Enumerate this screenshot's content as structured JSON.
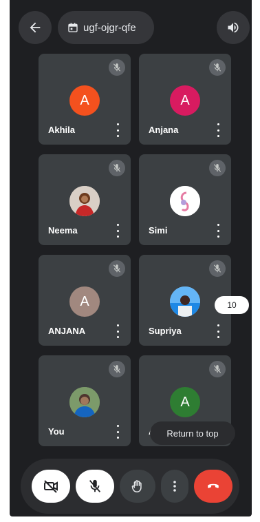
{
  "header": {
    "meeting_code": "ugf-ojgr-qfe",
    "icons": {
      "back": "arrow-back-icon",
      "calendar": "calendar-icon",
      "speaker": "speaker-icon"
    }
  },
  "participants": [
    {
      "name": "Akhila",
      "initial": "A",
      "avatar_color": "#f4511e",
      "muted": true
    },
    {
      "name": "Anjana",
      "initial": "A",
      "avatar_color": "#d81b60",
      "muted": true
    },
    {
      "name": "Neema",
      "initial": "",
      "avatar_photo": true,
      "muted": true
    },
    {
      "name": "Simi",
      "initial": "",
      "avatar_photo": true,
      "muted": true
    },
    {
      "name": "ANJANA",
      "initial": "A",
      "avatar_color": "#a1887f",
      "muted": true
    },
    {
      "name": "Supriya",
      "initial": "",
      "avatar_photo": true,
      "muted": true
    },
    {
      "name": "You",
      "initial": "",
      "avatar_photo": true,
      "muted": true
    },
    {
      "name": "A",
      "initial": "A",
      "avatar_color": "#2e7d32",
      "muted": true
    }
  ],
  "overlay": {
    "return_to_top": "Return to top",
    "page_badge": "10"
  },
  "controls": {
    "camera": "camera-off-icon",
    "mic": "mic-off-icon",
    "raise_hand": "hand-icon",
    "more": "more-vert-icon",
    "end_call": "call-end-icon",
    "end_color": "#ea4335"
  }
}
